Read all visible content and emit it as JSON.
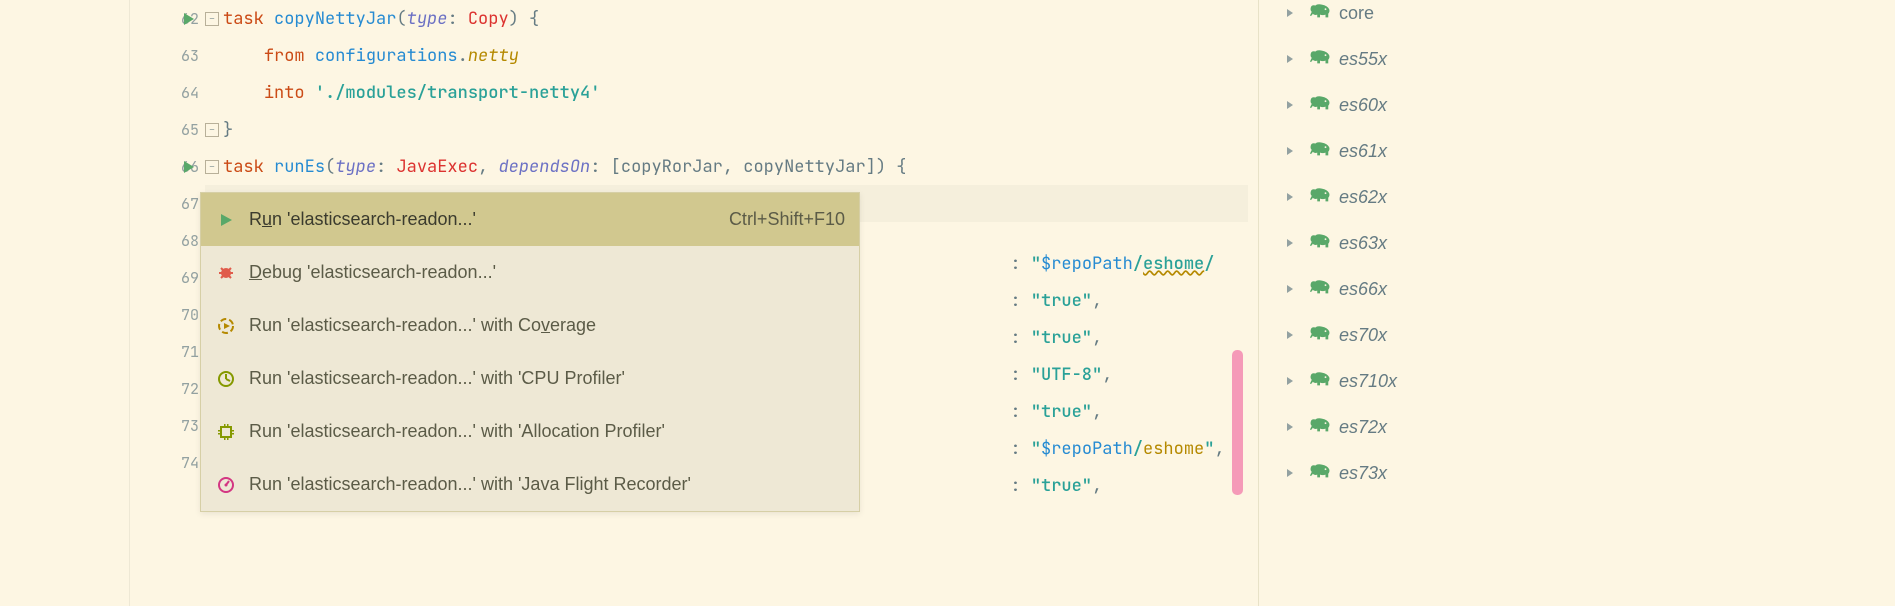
{
  "gutter": {
    "lines": [
      "62",
      "63",
      "64",
      "65",
      "66",
      "67",
      "68",
      "69",
      "70",
      "71",
      "72",
      "73",
      "74"
    ]
  },
  "code": {
    "l62": {
      "kw": "task",
      "name": "copyNettyJar",
      "type_lbl": "type",
      "type_val": "Copy",
      "tail": ") {"
    },
    "l63": {
      "kw": "from",
      "chain1": "configurations",
      "chain2": "netty"
    },
    "l64": {
      "kw": "into",
      "str": "'./modules/transport-netty4'"
    },
    "l65": {
      "brace": "}"
    },
    "l66": {
      "kw": "task",
      "name": "runEs",
      "type_lbl": "type",
      "type_val": "JavaExec",
      "deps_lbl": "dependsOn",
      "deps": "[copyRorJar, copyNettyJar]) {"
    },
    "rfrag68": {
      "lead": ": ",
      "q1": "\"",
      "var": "$repoPath",
      "slash": "/",
      "eshome": "eshome",
      "slash2": "/"
    },
    "rfrag69": {
      "lead": ": ",
      "val": "\"true\"",
      "comma": ","
    },
    "rfrag70": {
      "lead": ": ",
      "val": "\"true\"",
      "comma": ","
    },
    "rfrag71": {
      "lead": ": ",
      "val": "\"UTF-8\"",
      "comma": ","
    },
    "rfrag72": {
      "lead": ": ",
      "val": "\"true\"",
      "comma": ","
    },
    "rfrag73": {
      "lead": ": ",
      "q1": "\"",
      "var": "$repoPath",
      "slash": "/",
      "eshome": "eshome",
      "q2": "\"",
      "comma": ","
    },
    "rfrag74": {
      "lead": ": ",
      "val": "\"true\"",
      "comma": ","
    }
  },
  "menu": {
    "items": [
      {
        "pre": "R",
        "u": "u",
        "post": "n 'elasticsearch-readon...'",
        "shortcut": "Ctrl+Shift+F10",
        "icon": "run-icon",
        "selected": true
      },
      {
        "pre": "",
        "u": "D",
        "post": "ebug 'elasticsearch-readon...'",
        "shortcut": "",
        "icon": "debug-icon",
        "selected": false
      },
      {
        "pre": "Run 'elasticsearch-readon...' with Co",
        "u": "v",
        "post": "erage",
        "shortcut": "",
        "icon": "coverage-icon",
        "selected": false
      },
      {
        "pre": "Run 'elasticsearch-readon...' with 'CPU Profiler'",
        "u": "",
        "post": "",
        "shortcut": "",
        "icon": "profiler-cpu-icon",
        "selected": false
      },
      {
        "pre": "Run 'elasticsearch-readon...' with 'Allocation Profiler'",
        "u": "",
        "post": "",
        "shortcut": "",
        "icon": "profiler-alloc-icon",
        "selected": false
      },
      {
        "pre": "Run 'elasticsearch-readon...' with 'Java Flight Recorder'",
        "u": "",
        "post": "",
        "shortcut": "",
        "icon": "jfr-icon",
        "selected": false
      }
    ]
  },
  "tree": {
    "items": [
      {
        "label": "core",
        "italic": false
      },
      {
        "label": "es55x",
        "italic": true
      },
      {
        "label": "es60x",
        "italic": true
      },
      {
        "label": "es61x",
        "italic": true
      },
      {
        "label": "es62x",
        "italic": true
      },
      {
        "label": "es63x",
        "italic": true
      },
      {
        "label": "es66x",
        "italic": true
      },
      {
        "label": "es70x",
        "italic": true
      },
      {
        "label": "es710x",
        "italic": true
      },
      {
        "label": "es72x",
        "italic": true
      },
      {
        "label": "es73x",
        "italic": true
      }
    ]
  },
  "colors": {
    "run_green": "#59a869",
    "debug_red": "#e05b4b",
    "cov_olive": "#b58900",
    "prof_green": "#859900",
    "jfr_pink": "#d33682"
  }
}
